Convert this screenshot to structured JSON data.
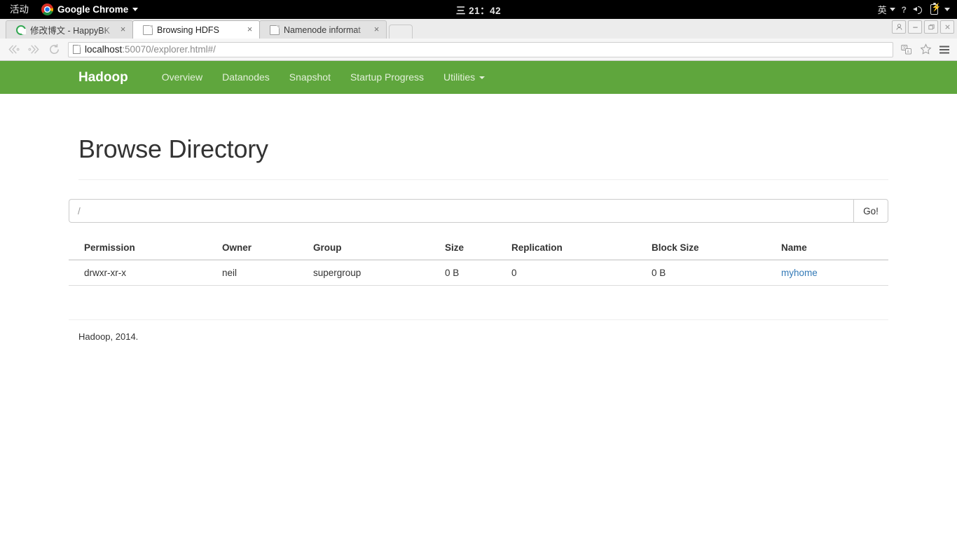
{
  "desktop": {
    "activities_label": "活动",
    "app_menu_label": "Google Chrome",
    "app_menu_icon": "chrome-logo-icon",
    "clock": "三 21：42",
    "tray": {
      "input_method": "英",
      "help_icon": "question-mark-icon",
      "volume_icon": "speaker-icon",
      "battery_icon": "battery-charging-icon",
      "menu_caret_icon": "chevron-down-icon"
    }
  },
  "browser": {
    "tabs": [
      {
        "title": "修改博文 - HappyBK",
        "favicon": "green-c-icon",
        "active": false,
        "close_label": "×"
      },
      {
        "title": "Browsing HDFS",
        "favicon": "page-icon",
        "active": true,
        "close_label": "×"
      },
      {
        "title": "Namenode informat",
        "favicon": "page-icon",
        "active": false,
        "close_label": "×"
      }
    ],
    "new_tab_label": "",
    "window_controls": {
      "profile_icon": "user-icon",
      "minimize_icon": "minimize-icon",
      "maximize_icon": "restore-icon",
      "close_icon": "close-icon"
    },
    "toolbar": {
      "back_icon": "back-arrow-icon",
      "forward_icon": "forward-arrow-icon",
      "reload_icon": "reload-icon",
      "page_icon": "page-icon",
      "url_host": "localhost",
      "url_rest": ":50070/explorer.html#/",
      "translate_icon": "translate-icon",
      "bookmark_icon": "star-icon",
      "menu_icon": "hamburger-menu-icon"
    }
  },
  "hadoop": {
    "brand": "Hadoop",
    "nav_items": [
      {
        "label": "Overview",
        "has_caret": false
      },
      {
        "label": "Datanodes",
        "has_caret": false
      },
      {
        "label": "Snapshot",
        "has_caret": false
      },
      {
        "label": "Startup Progress",
        "has_caret": false
      },
      {
        "label": "Utilities",
        "has_caret": true
      }
    ],
    "navbar_color": "#5fa63d",
    "page_title": "Browse Directory",
    "path_input": {
      "value": "/",
      "placeholder": "/"
    },
    "go_button": "Go!",
    "table": {
      "headers": [
        "Permission",
        "Owner",
        "Group",
        "Size",
        "Replication",
        "Block Size",
        "Name"
      ],
      "rows": [
        {
          "permission": "drwxr-xr-x",
          "owner": "neil",
          "group": "supergroup",
          "size": "0 B",
          "replication": "0",
          "block_size": "0 B",
          "name": "myhome",
          "name_color": "#337ab7"
        }
      ]
    },
    "footer": "Hadoop, 2014."
  }
}
